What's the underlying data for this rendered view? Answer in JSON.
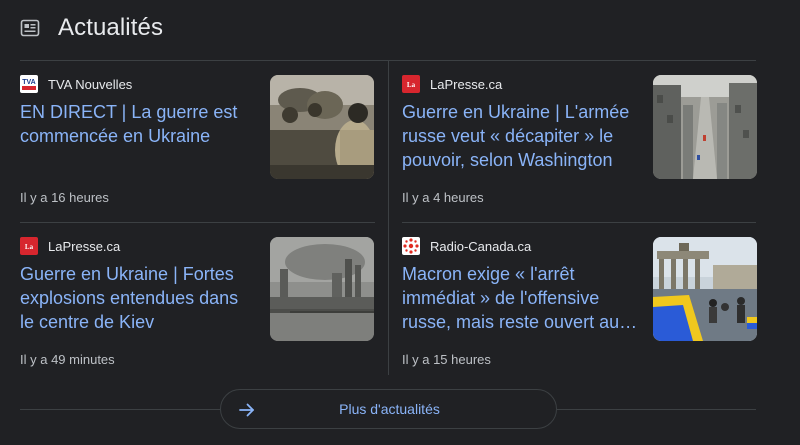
{
  "header": {
    "title": "Actualités",
    "icon": "news-icon"
  },
  "articles": [
    {
      "source": "TVA Nouvelles",
      "favicon": "tva-nouvelles-logo",
      "headline": "EN DIRECT | La guerre est commencée en Ukraine",
      "time": "Il y a 16 heures",
      "thumbnail": "soldiers-on-armored-vehicle-photo"
    },
    {
      "source": "LaPresse.ca",
      "favicon": "lapresse-logo",
      "headline": "Guerre en Ukraine | L'armée russe veut « décapiter » le pouvoir, selon Washington",
      "time": "Il y a 4 heures",
      "thumbnail": "city-avenue-aerial-photo"
    },
    {
      "source": "LaPresse.ca",
      "favicon": "lapresse-logo",
      "headline": "Guerre en Ukraine | Fortes explosions entendues dans le centre de Kiev",
      "time": "Il y a 49 minutes",
      "thumbnail": "smoky-city-skyline-photo"
    },
    {
      "source": "Radio-Canada.ca",
      "favicon": "radio-canada-logo",
      "headline": "Macron exige « l'arrêt immédiat » de l'offensive russe, mais reste ouvert au…",
      "time": "Il y a 15 heures",
      "thumbnail": "brandenburg-gate-protest-photo"
    }
  ],
  "more_button": {
    "label": "Plus d'actualités",
    "icon": "arrow-right-icon"
  },
  "colors": {
    "background": "#202124",
    "link": "#8ab4f8",
    "text": "#e8eaed",
    "muted": "#bdc1c6",
    "divider": "#3c4043"
  }
}
